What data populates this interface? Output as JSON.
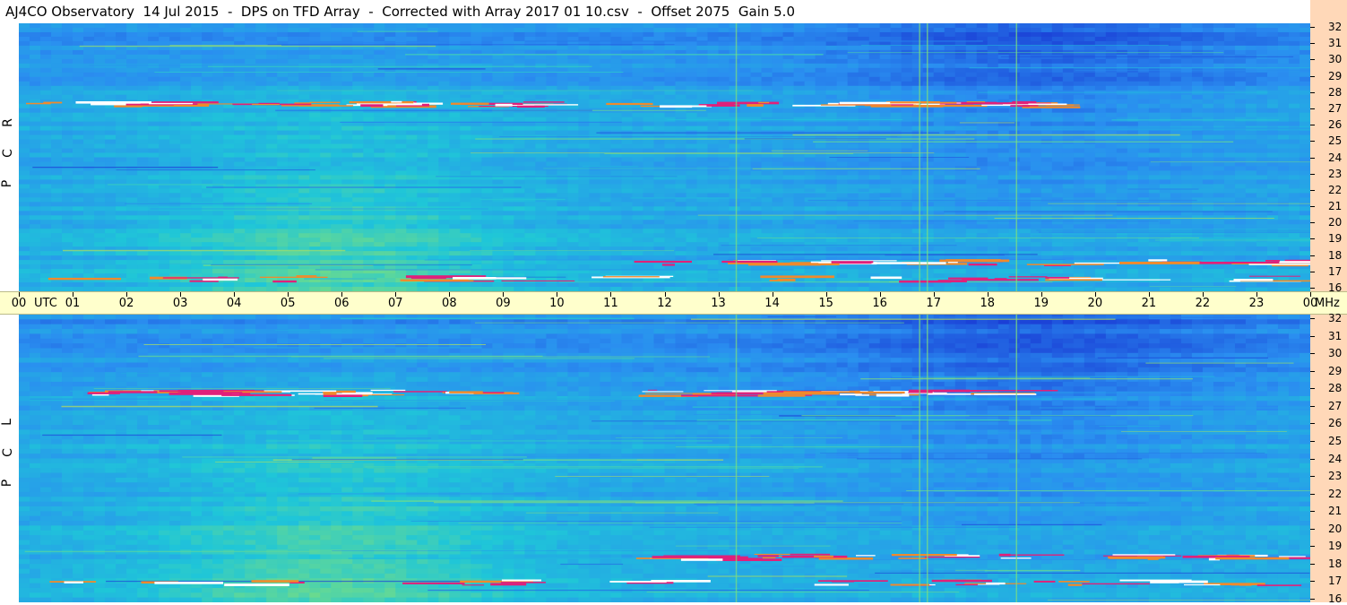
{
  "title": "AJ4CO Observatory  14 Jul 2015  -  DPS on TFD Array  -  Corrected with Array 2017 01 10.csv  -  Offset 2075  Gain 5.0",
  "time_axis": {
    "utc_label": "UTC",
    "mhz_label": "MHz"
  },
  "panels": [
    {
      "id": "rcp",
      "label": "R C P"
    },
    {
      "id": "lcp",
      "label": "L C P"
    }
  ],
  "chart_data": {
    "type": "heatmap",
    "title": "AJ4CO Observatory  14 Jul 2015  -  DPS on TFD Array  -  Corrected with Array 2017 01 10.csv  -  Offset 2075  Gain 5.0",
    "x_ticks": [
      "00",
      "01",
      "02",
      "03",
      "04",
      "05",
      "06",
      "07",
      "08",
      "09",
      "10",
      "11",
      "12",
      "13",
      "14",
      "15",
      "16",
      "17",
      "18",
      "19",
      "20",
      "21",
      "22",
      "23",
      "00"
    ],
    "xlabel": "UTC",
    "xlim": [
      0,
      24
    ],
    "ylabel": "MHz",
    "ylim": [
      16,
      32
    ],
    "y_ticks": [
      16,
      17,
      18,
      19,
      20,
      21,
      22,
      23,
      24,
      25,
      26,
      27,
      28,
      29,
      30,
      31,
      32
    ],
    "series": [
      {
        "name": "R C P"
      },
      {
        "name": "L C P"
      }
    ],
    "colors": [
      "#1b3fd6",
      "#2a8ef0",
      "#1fc6d8",
      "#7fe07a",
      "#e8e03a",
      "#f08a2c",
      "#e0207a",
      "#ffffff"
    ],
    "grid": false
  }
}
